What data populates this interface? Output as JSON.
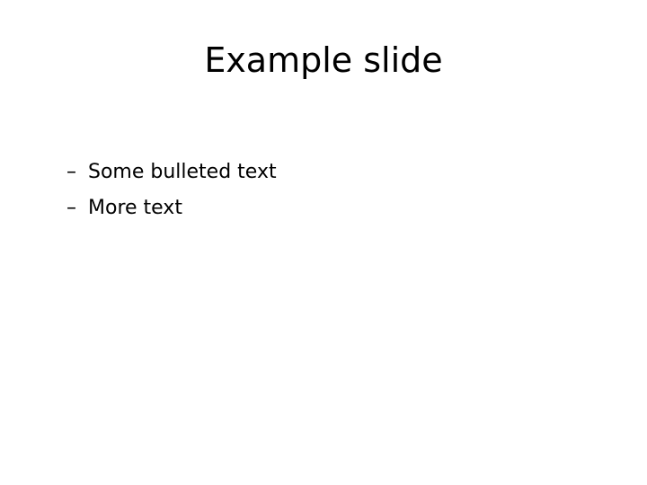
{
  "slide": {
    "title": "Example slide",
    "bullet_marker": "–",
    "bullets": [
      "Some bulleted text",
      "More text"
    ]
  }
}
